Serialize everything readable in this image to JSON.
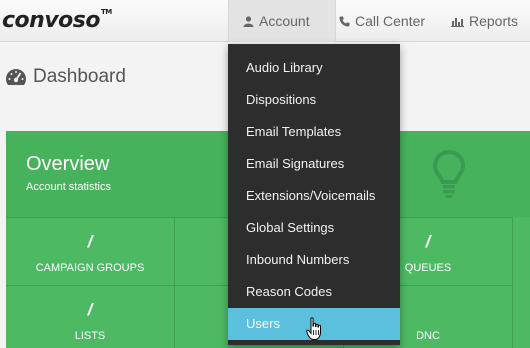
{
  "brand": {
    "name": "convoso",
    "tm": "TM"
  },
  "nav": {
    "account": "Account",
    "call_center": "Call Center",
    "reports": "Reports"
  },
  "page": {
    "title": "Dashboard"
  },
  "overview": {
    "title": "Overview",
    "subtitle": "Account statistics",
    "stats": [
      {
        "value": "/",
        "label": "CAMPAIGN GROUPS"
      },
      {
        "value": "",
        "label": ""
      },
      {
        "value": "/",
        "label": "QUEUES"
      },
      {
        "value": "/",
        "label": "LISTS"
      },
      {
        "value": "",
        "label": ""
      },
      {
        "value": "",
        "label": "DNC"
      }
    ]
  },
  "account_menu": {
    "items": [
      "Audio Library",
      "Dispositions",
      "Email Templates",
      "Email Signatures",
      "Extensions/Voicemails",
      "Global Settings",
      "Inbound Numbers",
      "Reason Codes",
      "Users"
    ],
    "active_index": 8
  },
  "colors": {
    "panel_green": "#4db963",
    "menu_bg": "#2d2d2d",
    "menu_active": "#5bc0de"
  }
}
